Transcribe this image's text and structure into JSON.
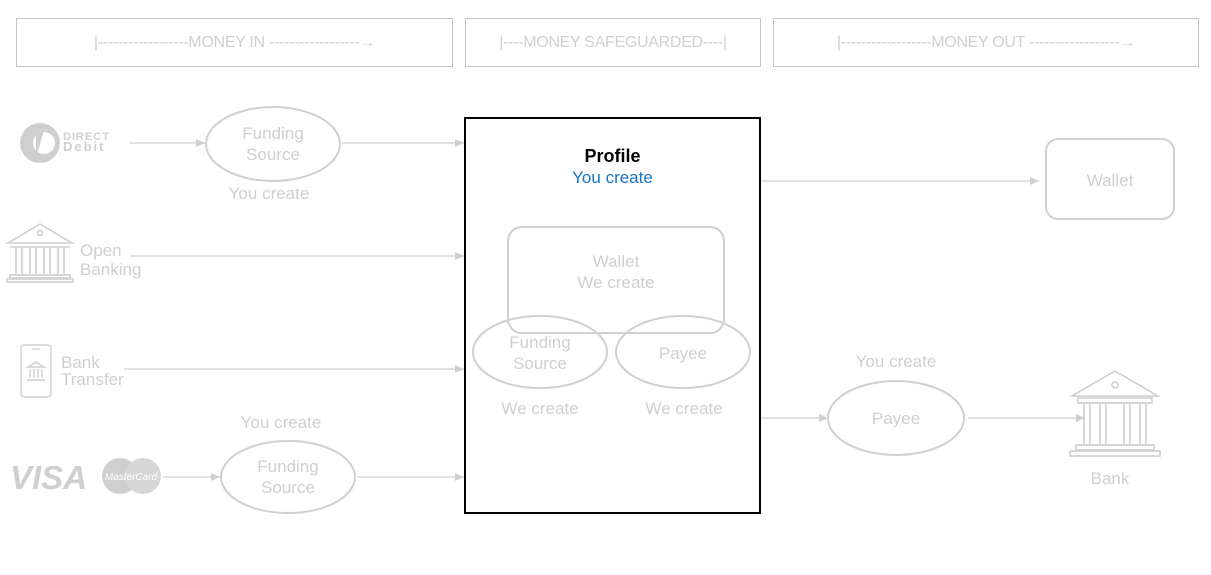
{
  "headers": {
    "money_in": "|------------------MONEY IN ------------------→",
    "money_safeguarded": "|----MONEY SAFEGUARDED----|",
    "money_out": "|------------------MONEY OUT ------------------→"
  },
  "sources": {
    "direct_debit": {
      "logo_top": "DIRECT",
      "logo_bottom": "Debit",
      "icon": "direct-debit-logo"
    },
    "open_banking": {
      "label_line1": "Open",
      "label_line2": "Banking",
      "icon": "bank-building-icon"
    },
    "bank_transfer": {
      "label_line1": "Bank",
      "label_line2": "Transfer",
      "icon": "mobile-bank-icon"
    },
    "cards": {
      "visa": "VISA",
      "mastercard": "MasterCard"
    }
  },
  "funding_top": {
    "line1": "Funding",
    "line2": "Source",
    "caption": "You create"
  },
  "funding_bottom": {
    "line1": "Funding",
    "line2": "Source",
    "caption": "You create"
  },
  "profile": {
    "title": "Profile",
    "subtitle": "You create",
    "wallet": {
      "line1": "Wallet",
      "line2": "We create"
    },
    "funding": {
      "line1": "Funding",
      "line2": "Source",
      "caption": "We create"
    },
    "payee": {
      "label": "Payee",
      "caption": "We create"
    }
  },
  "out": {
    "wallet": "Wallet",
    "payee": {
      "label": "Payee",
      "caption": "You create"
    },
    "bank": "Bank"
  },
  "colors": {
    "muted": "#cfcfcf",
    "border": "#c4c4c4",
    "accent": "#1a73be",
    "profile_border": "#000000"
  }
}
